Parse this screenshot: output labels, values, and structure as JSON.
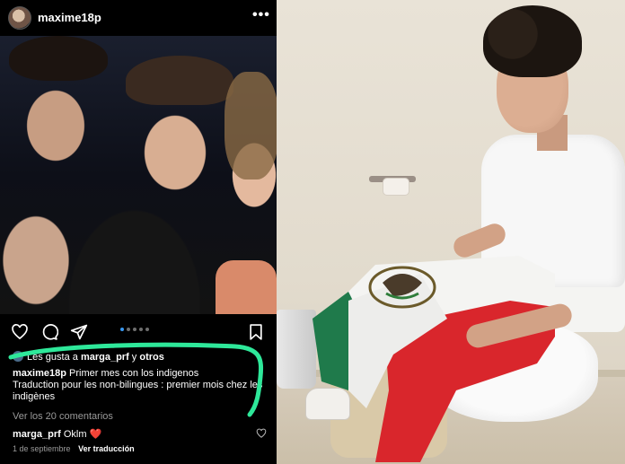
{
  "instagram": {
    "username": "maxime18p",
    "more_icon": "more-icon",
    "carousel": {
      "count": 5,
      "active_index": 0
    },
    "likes": {
      "prefix": "Les gusta a ",
      "user": "marga_prf",
      "middle": " y ",
      "others": "otros"
    },
    "caption": {
      "user": "maxime18p",
      "text": "Primer mes con los indigenos",
      "translation": "Traduction pour les non-bilingues : premier mois chez les indigènes"
    },
    "view_comments": "Ver los 20 comentarios",
    "comment": {
      "user": "marga_prf",
      "text": "Oklm",
      "emoji": "❤️"
    },
    "date": "1 de septiembre",
    "see_translation": "Ver traducción",
    "colors": {
      "background": "#000000",
      "annotation_green": "#2ee89a",
      "heart_red": "#ed2a3e",
      "carousel_active": "#3897f0"
    }
  }
}
